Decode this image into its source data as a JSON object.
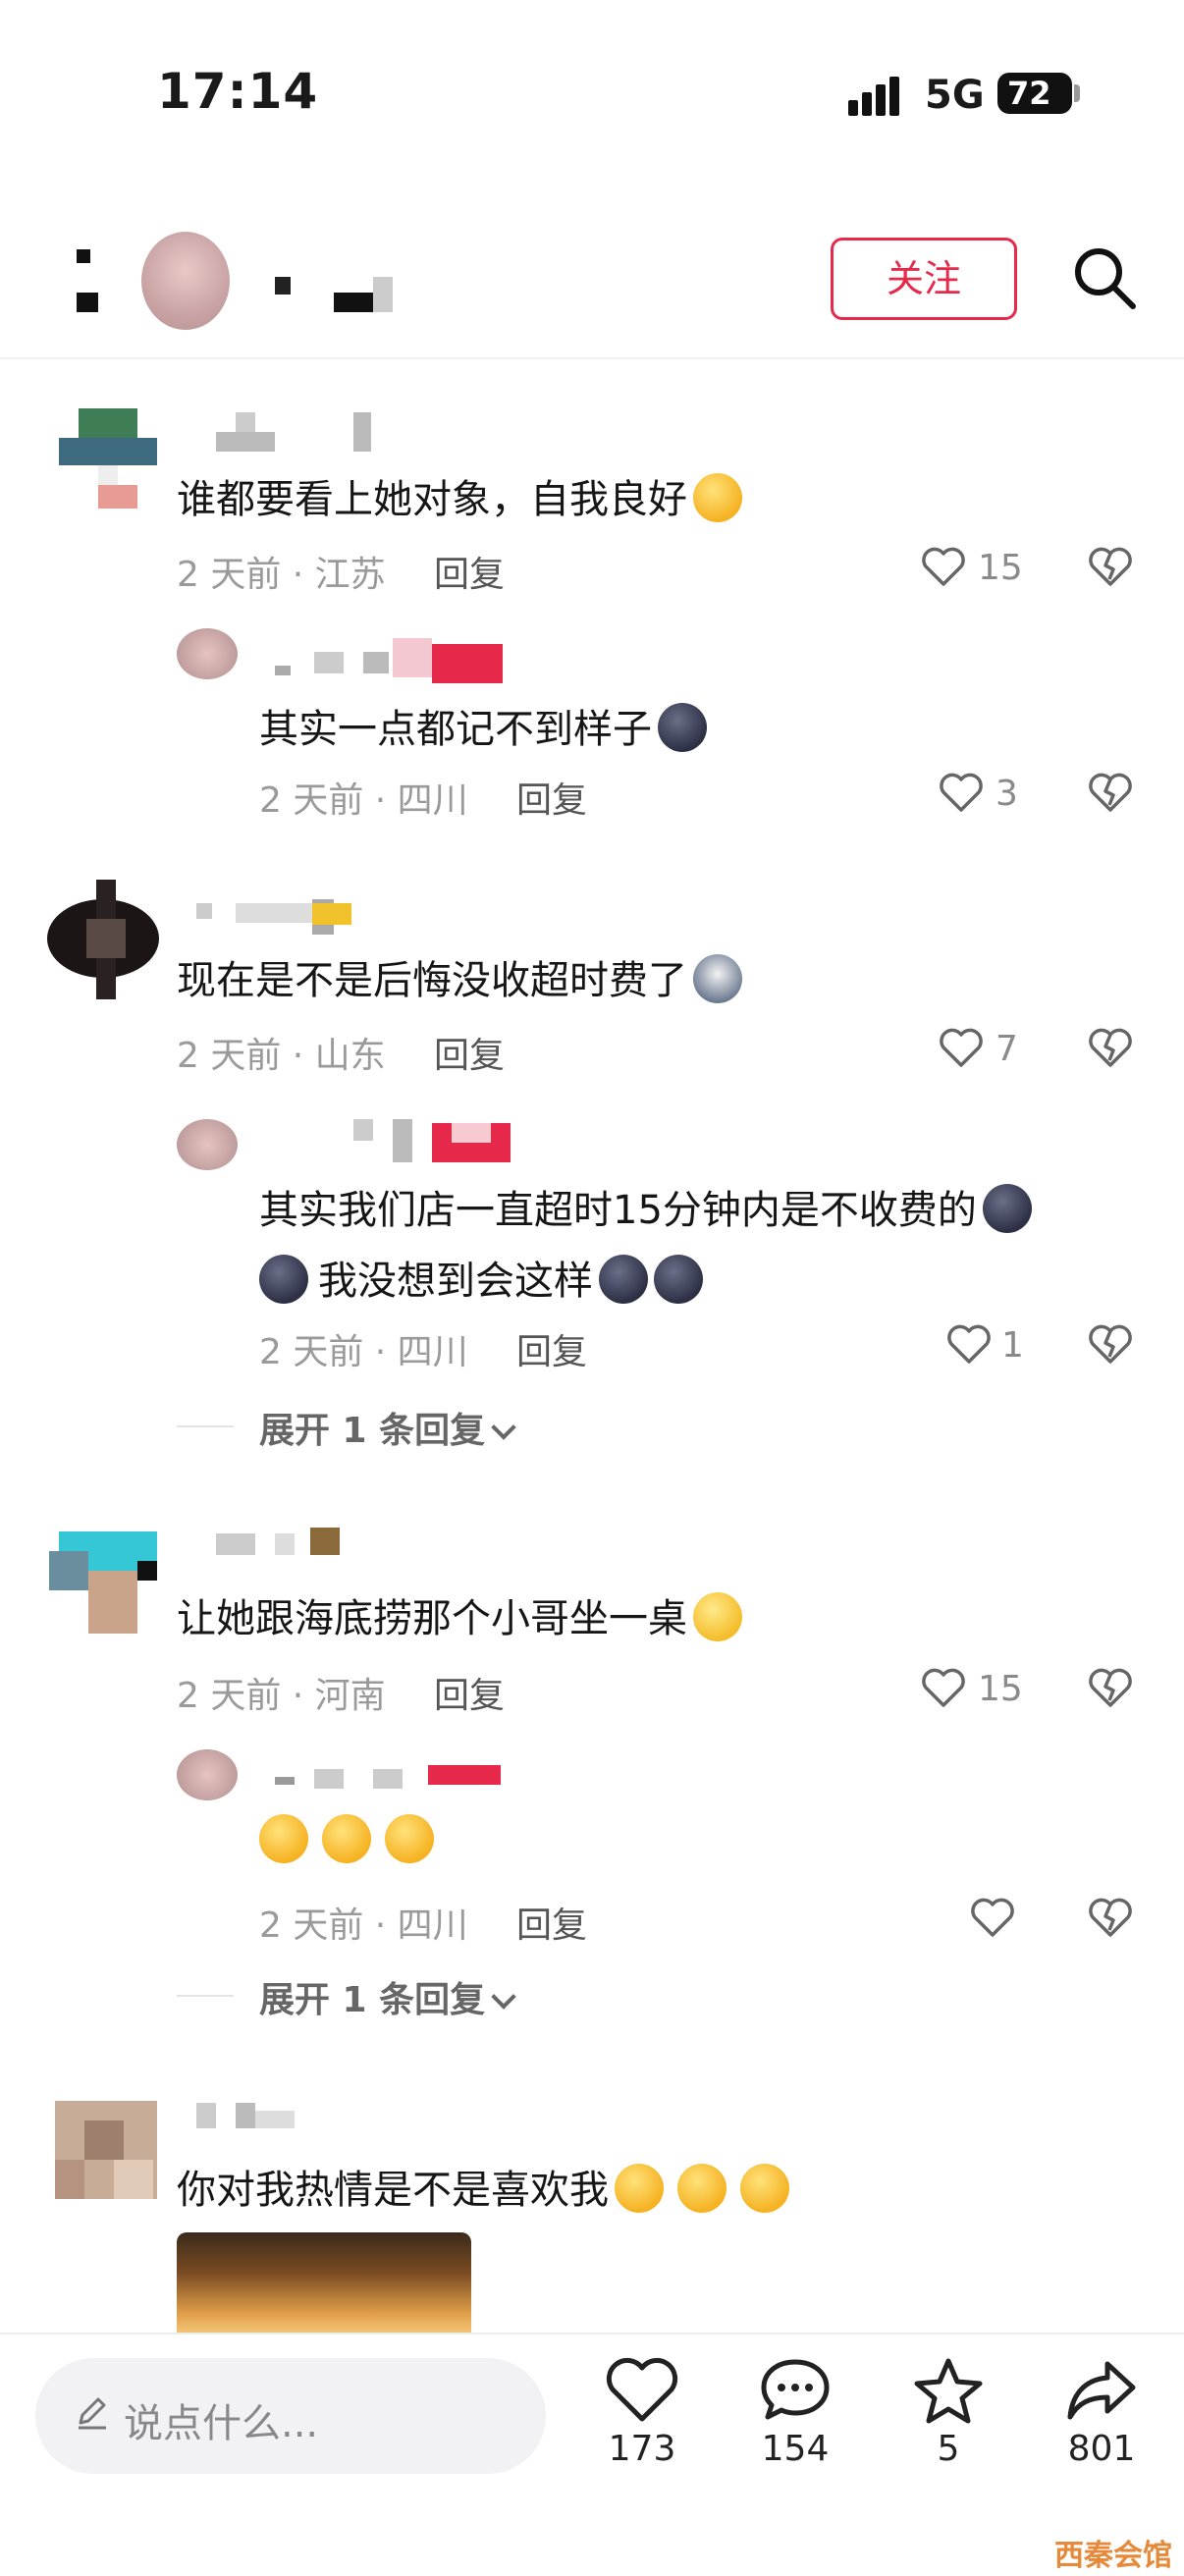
{
  "status_bar": {
    "time": "17:14",
    "network": "5G",
    "battery": "72"
  },
  "header": {
    "follow_label": "关注"
  },
  "comments": [
    {
      "text": "谁都要看上她对象，自我良好",
      "meta": "2 天前 · 江苏",
      "reply_label": "回复",
      "likes": "15",
      "replies": [
        {
          "text": "其实一点都记不到样子",
          "meta": "2 天前 · 四川",
          "reply_label": "回复",
          "likes": "3"
        }
      ]
    },
    {
      "text": "现在是不是后悔没收超时费了",
      "meta": "2 天前 · 山东",
      "reply_label": "回复",
      "likes": "7",
      "replies": [
        {
          "text_line1": "其实我们店一直超时15分钟内是不收费的",
          "text_line2": "我没想到会这样",
          "meta": "2 天前 · 四川",
          "reply_label": "回复",
          "likes": "1"
        }
      ],
      "expand_label": "展开 1 条回复"
    },
    {
      "text": "让她跟海底捞那个小哥坐一桌",
      "meta": "2 天前 · 河南",
      "reply_label": "回复",
      "likes": "15",
      "replies": [
        {
          "text": "",
          "meta": "2 天前 · 四川",
          "reply_label": "回复",
          "likes": ""
        }
      ],
      "expand_label": "展开 1 条回复"
    },
    {
      "text": "你对我热情是不是喜欢我"
    }
  ],
  "bottom_bar": {
    "input_placeholder": "说点什么...",
    "like_count": "173",
    "comment_count": "154",
    "favorite_count": "5",
    "share_count": "801"
  },
  "watermark": "西秦会馆",
  "colors": {
    "accent": "#e6284b",
    "meta_gray": "#9a9a9a"
  }
}
